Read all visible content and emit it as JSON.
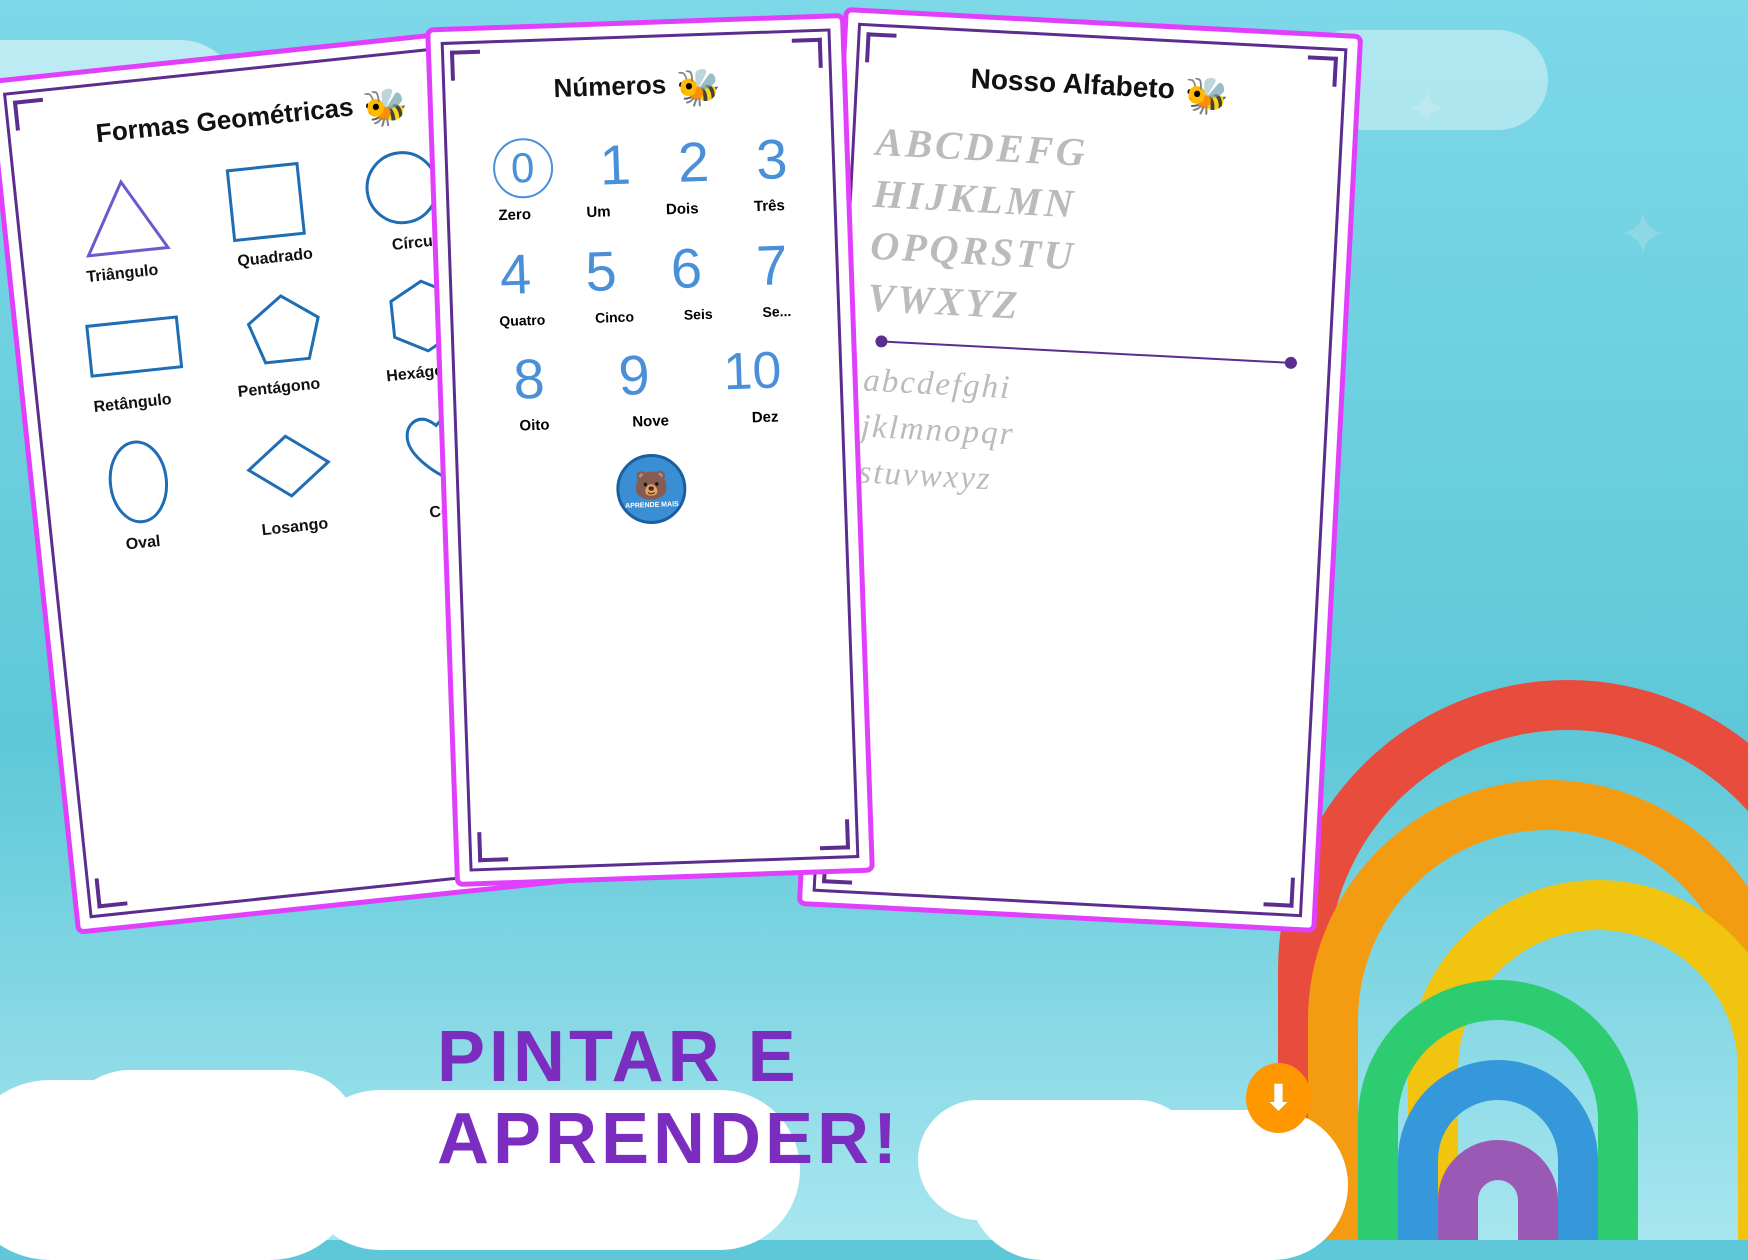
{
  "background": {
    "color": "#5ec8d8"
  },
  "bottomText": {
    "title": "PINTAR E APRENDER!",
    "downloadIcon": "⬇"
  },
  "card1": {
    "title": "Formas Geométricas",
    "shapes": [
      {
        "name": "Triângulo",
        "type": "triangle"
      },
      {
        "name": "Quadrado",
        "type": "square"
      },
      {
        "name": "Círculo",
        "type": "circle"
      },
      {
        "name": "Retângulo",
        "type": "rectangle"
      },
      {
        "name": "Pentágono",
        "type": "pentagon"
      },
      {
        "name": "Hexágono",
        "type": "hexagon"
      },
      {
        "name": "Oval",
        "type": "oval"
      },
      {
        "name": "Losango",
        "type": "diamond"
      },
      {
        "name": "Cor...",
        "type": "heart"
      }
    ]
  },
  "card2": {
    "title": "Números",
    "numbers": [
      {
        "digit": "0",
        "label": "Zero",
        "bordered": true
      },
      {
        "digit": "1",
        "label": "Um",
        "bordered": false
      },
      {
        "digit": "2",
        "label": "Dois",
        "bordered": false
      },
      {
        "digit": "3",
        "label": "Três",
        "bordered": false
      },
      {
        "digit": "4",
        "label": "Quatro",
        "bordered": false
      },
      {
        "digit": "5",
        "label": "Cinco",
        "bordered": false
      },
      {
        "digit": "6",
        "label": "Seis",
        "bordered": false
      },
      {
        "digit": "7",
        "label": "Se...",
        "bordered": false
      },
      {
        "digit": "8",
        "label": "Oito",
        "bordered": false
      },
      {
        "digit": "9",
        "label": "Nove",
        "bordered": false
      },
      {
        "digit": "10",
        "label": "Dez",
        "bordered": false
      }
    ],
    "logoText": "APRENDE MAIS"
  },
  "card3": {
    "title": "Nosso Alfabeto",
    "uppercase": "ABCDEFG HIJKLMN OPQRSTU VWXYZ",
    "uppercase_lines": [
      "ABCDEFG",
      "HIJKLMN",
      "OPQRSTU",
      "VWXYZ"
    ],
    "lowercase_lines": [
      "abcdefghi",
      "jklmnopqr",
      "stuvwxyz"
    ]
  }
}
